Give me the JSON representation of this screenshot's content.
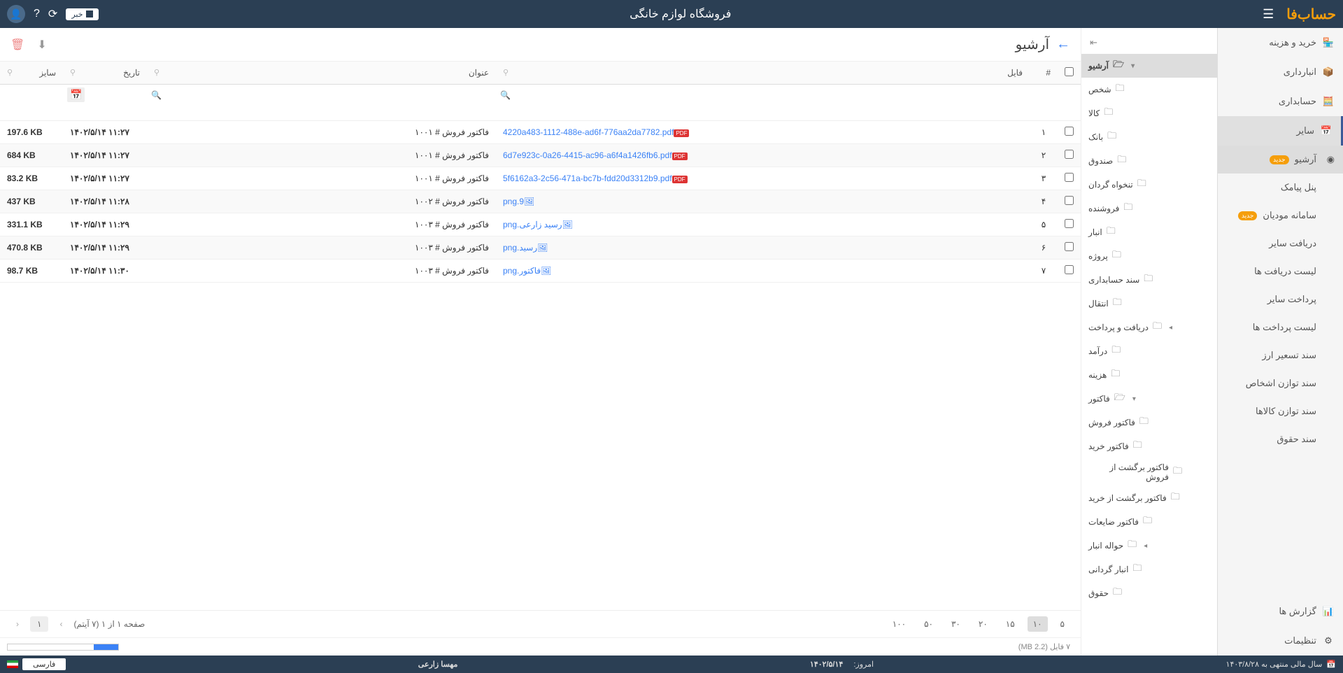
{
  "header": {
    "app_title": "فروشگاه لوازم خانگی",
    "logo_text": "حساب",
    "logo_suffix": "فا",
    "news_label": "خبر"
  },
  "main_sidebar": {
    "items": [
      {
        "label": "خرید و هزینه",
        "icon": "shop"
      },
      {
        "label": "انبارداری",
        "icon": "warehouse"
      },
      {
        "label": "حسابداری",
        "icon": "acc"
      },
      {
        "label": "سایر",
        "icon": "other",
        "active": true
      }
    ],
    "sub_items": [
      {
        "label": "آرشیو",
        "badge": "جدید",
        "selected": true
      },
      {
        "label": "پنل پیامک"
      },
      {
        "label": "سامانه مودیان",
        "badge": "جدید"
      },
      {
        "label": "دریافت سایر"
      },
      {
        "label": "لیست دریافت ها"
      },
      {
        "label": "پرداخت سایر"
      },
      {
        "label": "لیست پرداخت ها"
      },
      {
        "label": "سند تسعیر ارز"
      },
      {
        "label": "سند توازن اشخاص"
      },
      {
        "label": "سند توازن کالاها"
      },
      {
        "label": "سند حقوق"
      }
    ],
    "bottom": [
      {
        "label": "گزارش ها",
        "icon": "report"
      },
      {
        "label": "تنظیمات",
        "icon": "settings"
      }
    ]
  },
  "tree": {
    "root_label": "آرشیو",
    "items": [
      {
        "label": "شخص",
        "level": 1
      },
      {
        "label": "کالا",
        "level": 1
      },
      {
        "label": "بانک",
        "level": 1
      },
      {
        "label": "صندوق",
        "level": 1
      },
      {
        "label": "تنخواه گردان",
        "level": 1
      },
      {
        "label": "فروشنده",
        "level": 1
      },
      {
        "label": "انبار",
        "level": 1
      },
      {
        "label": "پروژه",
        "level": 1
      },
      {
        "label": "سند حسابداری",
        "level": 1
      },
      {
        "label": "انتقال",
        "level": 1
      },
      {
        "label": "دریافت و پرداخت",
        "level": 1,
        "expandable": true
      },
      {
        "label": "درآمد",
        "level": 1
      },
      {
        "label": "هزینه",
        "level": 1
      },
      {
        "label": "فاکتور",
        "level": 1,
        "expandable": true,
        "expanded": true
      },
      {
        "label": "فاکتور فروش",
        "level": 2
      },
      {
        "label": "فاکتور خرید",
        "level": 2
      },
      {
        "label": "فاکتور برگشت از فروش",
        "level": 2
      },
      {
        "label": "فاکتور برگشت از خرید",
        "level": 2
      },
      {
        "label": "فاکتور ضایعات",
        "level": 2
      },
      {
        "label": "حواله انبار",
        "level": 1,
        "expandable": true
      },
      {
        "label": "انبار گردانی",
        "level": 1
      },
      {
        "label": "حقوق",
        "level": 1
      }
    ]
  },
  "content": {
    "title": "آرشیو"
  },
  "table": {
    "columns": {
      "num": "#",
      "file": "فایل",
      "title": "عنوان",
      "date": "تاریخ",
      "size": "سایز"
    },
    "rows": [
      {
        "n": "۱",
        "file": "4220a483-1112-488e-ad6f-776aa2da7782.pdf",
        "ftype": "pdf",
        "title": "فاکتور فروش # ۱۰۰۱",
        "date": "۱۴۰۲/۵/۱۴ ۱۱:۲۷",
        "size": "197.6 KB"
      },
      {
        "n": "۲",
        "file": "6d7e923c-0a26-4415-ac96-a6f4a1426fb6.pdf",
        "ftype": "pdf",
        "title": "فاکتور فروش # ۱۰۰۱",
        "date": "۱۴۰۲/۵/۱۴ ۱۱:۲۷",
        "size": "684 KB"
      },
      {
        "n": "۳",
        "file": "5f6162a3-2c56-471a-bc7b-fdd20d3312b9.pdf",
        "ftype": "pdf",
        "title": "فاکتور فروش # ۱۰۰۱",
        "date": "۱۴۰۲/۵/۱۴ ۱۱:۲۷",
        "size": "83.2 KB"
      },
      {
        "n": "۴",
        "file": "png.9",
        "ftype": "png",
        "title": "فاکتور فروش # ۱۰۰۲",
        "date": "۱۴۰۲/۵/۱۴ ۱۱:۲۸",
        "size": "437 KB"
      },
      {
        "n": "۵",
        "file": "رسید زارعی.png",
        "ftype": "png",
        "title": "فاکتور فروش # ۱۰۰۳",
        "date": "۱۴۰۲/۵/۱۴ ۱۱:۲۹",
        "size": "331.1 KB"
      },
      {
        "n": "۶",
        "file": "رسید.png",
        "ftype": "png",
        "title": "فاکتور فروش # ۱۰۰۳",
        "date": "۱۴۰۲/۵/۱۴ ۱۱:۲۹",
        "size": "470.8 KB"
      },
      {
        "n": "۷",
        "file": "فاکتور.png",
        "ftype": "png",
        "title": "فاکتور فروش # ۱۰۰۳",
        "date": "۱۴۰۲/۵/۱۴ ۱۱:۳۰",
        "size": "98.7 KB"
      }
    ],
    "page_sizes": [
      "۵",
      "۱۰",
      "۱۵",
      "۲۰",
      "۳۰",
      "۵۰",
      "۱۰۰"
    ],
    "active_page_size": "۱۰",
    "pager_text": "صفحه ۱ از ۱ (۷ آیتم)",
    "current_page": "۱",
    "stats": "۷ فایل (MB 2.2)",
    "progress_pct": 22
  },
  "status": {
    "fiscal_year": "سال مالی منتهی به ۱۴۰۳/۸/۲۸",
    "today_label": "امروز:",
    "today_value": "۱۴۰۲/۵/۱۴",
    "user": "مهسا زارعی",
    "lang": "فارسی"
  }
}
